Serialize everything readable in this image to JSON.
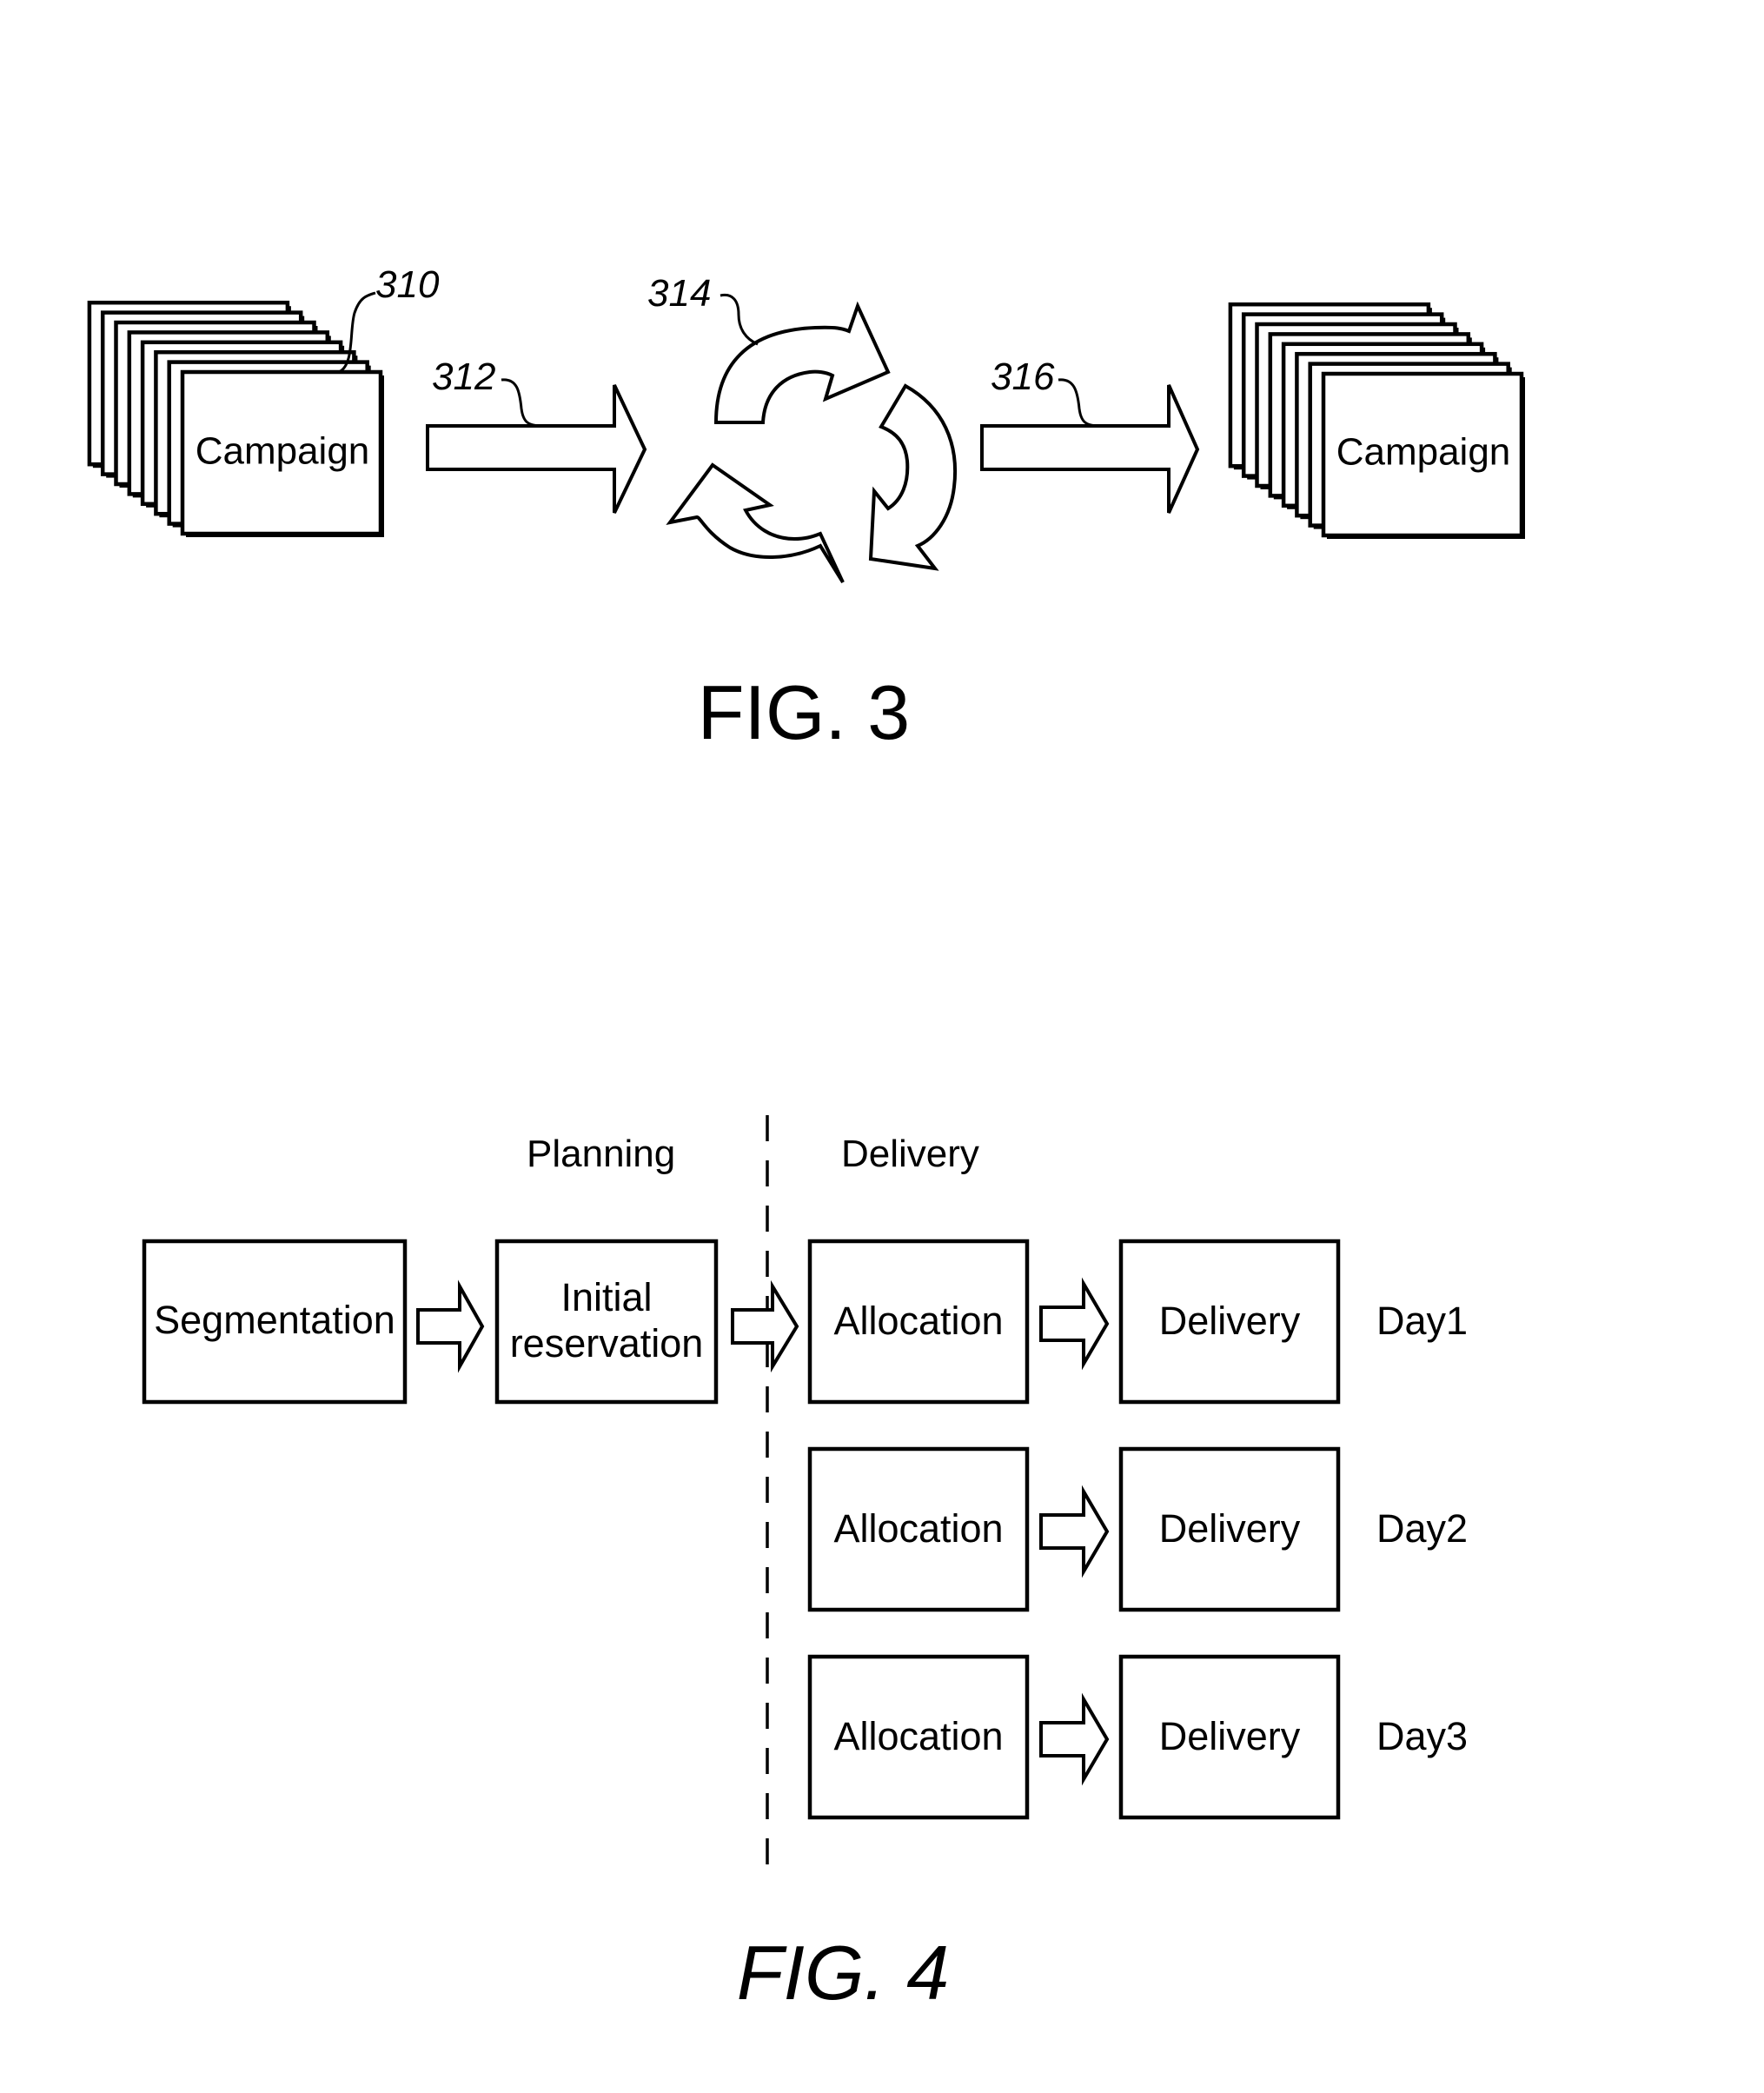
{
  "figure3": {
    "caption": "FIG. 3",
    "input_stack": {
      "ref": "310",
      "card_label": "Campaign",
      "card_count": 8
    },
    "arrow_in": {
      "ref": "312"
    },
    "cycle": {
      "ref": "314",
      "arrow_count": 3
    },
    "arrow_out": {
      "ref": "316"
    },
    "output_stack": {
      "card_label": "Campaign",
      "card_count": 8
    }
  },
  "figure4": {
    "caption": "FIG. 4",
    "phases": {
      "planning": "Planning",
      "delivery": "Delivery"
    },
    "planning_boxes": [
      {
        "label": "Segmentation"
      },
      {
        "label_line1": "Initial",
        "label_line2": "reservation"
      }
    ],
    "rows": [
      {
        "allocation": "Allocation",
        "delivery": "Delivery",
        "day": "Day1"
      },
      {
        "allocation": "Allocation",
        "delivery": "Delivery",
        "day": "Day2"
      },
      {
        "allocation": "Allocation",
        "delivery": "Delivery",
        "day": "Day3"
      }
    ]
  }
}
